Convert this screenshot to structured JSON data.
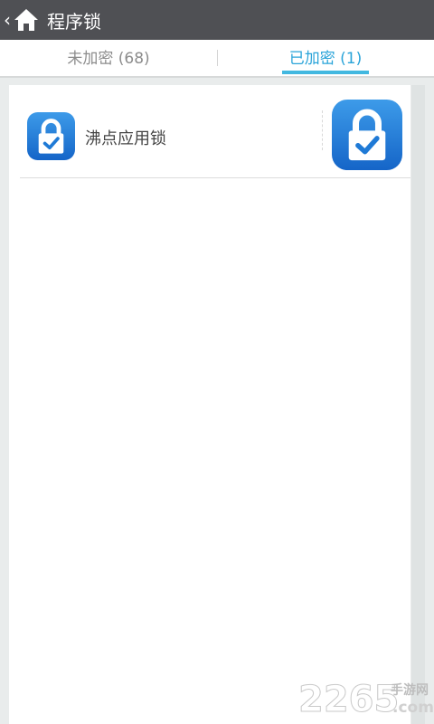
{
  "header": {
    "title": "程序锁",
    "back_icon": "chevron-left-icon",
    "home_icon": "home-icon"
  },
  "tabs": [
    {
      "label": "未加密 (68)",
      "active": false
    },
    {
      "label": "已加密 (1)",
      "active": true
    }
  ],
  "apps": [
    {
      "name": "沸点应用锁",
      "icon": "padlock-check-icon",
      "locked": true
    }
  ],
  "watermark": {
    "number": "2265",
    "domain": ".com",
    "text": "手游网"
  },
  "colors": {
    "header_bg": "#4f5054",
    "active_tab": "#2aa4d9",
    "inactive_tab": "#8c8c8c",
    "app_icon_blue": "#1f7ad6"
  }
}
